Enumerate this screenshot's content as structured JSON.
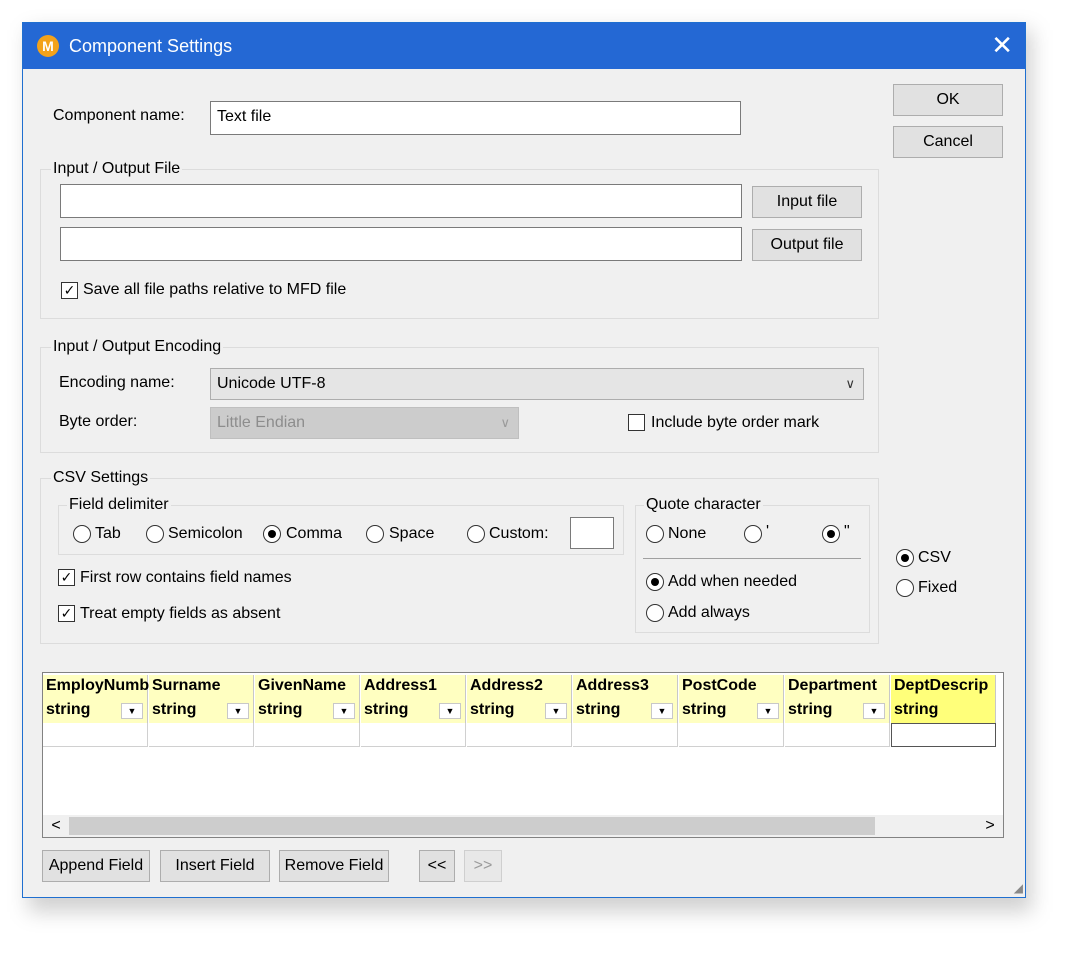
{
  "window": {
    "title": "Component Settings",
    "close_glyph": "✕",
    "app_icon": "M",
    "icon_color": "#f3a21a",
    "titlebar_color": "#2468d4"
  },
  "component": {
    "label": "Component name:",
    "value": "Text file"
  },
  "buttons": {
    "ok": "OK",
    "cancel": "Cancel"
  },
  "io_file": {
    "group_title": "Input / Output File",
    "input_value": "",
    "output_value": "",
    "input_button": "Input file",
    "output_button": "Output file",
    "save_relative_label": "Save all file paths relative to MFD file",
    "save_relative_checked": true
  },
  "encoding": {
    "group_title": "Input / Output Encoding",
    "name_label": "Encoding name:",
    "name_value": "Unicode UTF-8",
    "byte_order_label": "Byte order:",
    "byte_order_value": "Little Endian",
    "bom_label": "Include byte order mark",
    "bom_checked": false
  },
  "csv": {
    "group_title": "CSV Settings",
    "field_delimiter": {
      "title": "Field delimiter",
      "options": [
        "Tab",
        "Semicolon",
        "Comma",
        "Space",
        "Custom:"
      ],
      "selected": "Comma",
      "custom_value": ""
    },
    "quote": {
      "title": "Quote character",
      "options": [
        "None",
        "'",
        "\""
      ],
      "selected": "\"",
      "mode_options": [
        "Add when needed",
        "Add always"
      ],
      "mode_selected": "Add when needed"
    },
    "first_row_label": "First row contains field names",
    "first_row_checked": true,
    "empty_fields_label": "Treat empty fields as absent",
    "empty_fields_checked": true
  },
  "format": {
    "options": [
      "CSV",
      "Fixed"
    ],
    "selected": "CSV"
  },
  "grid": {
    "columns": [
      {
        "name": "EmployNumb",
        "type": "string"
      },
      {
        "name": "Surname",
        "type": "string"
      },
      {
        "name": "GivenName",
        "type": "string"
      },
      {
        "name": "Address1",
        "type": "string"
      },
      {
        "name": "Address2",
        "type": "string"
      },
      {
        "name": "Address3",
        "type": "string"
      },
      {
        "name": "PostCode",
        "type": "string"
      },
      {
        "name": "Department",
        "type": "string"
      },
      {
        "name": "DeptDescrip",
        "type": "string"
      }
    ],
    "selected_column": "DeptDescrip",
    "scroll_left": "<",
    "scroll_right": ">"
  },
  "bottom": {
    "append": "Append Field",
    "insert": "Insert Field",
    "remove": "Remove Field",
    "prev": "<<",
    "next": ">>"
  }
}
